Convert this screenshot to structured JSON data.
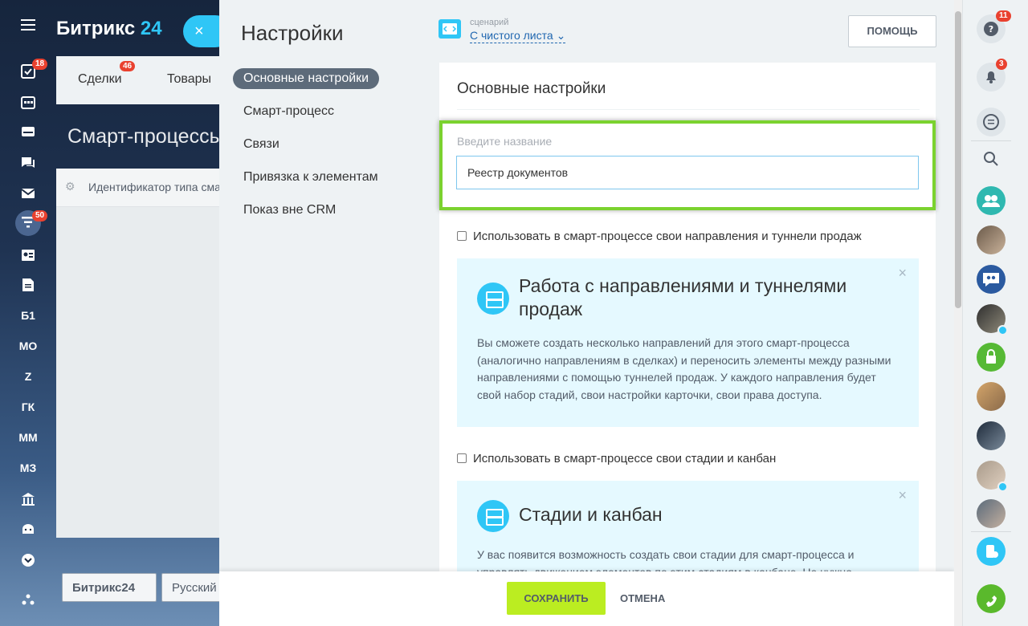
{
  "background": {
    "logo_text": "Битрикс",
    "logo_num": "24",
    "close_label": "×",
    "tabs": [
      {
        "label": "Сделки",
        "badge": "46"
      },
      {
        "label": "Товары"
      }
    ],
    "page_title": "Смарт-процессы",
    "table_row": "Идентификатор типа смарт-процесса",
    "footer_logo": "Битрикс24",
    "footer_lang": "Русский"
  },
  "left_nav": [
    {
      "icon": "tasks-icon",
      "badge": "18"
    },
    {
      "icon": "calendar-icon"
    },
    {
      "icon": "drive-icon"
    },
    {
      "icon": "chat-icon"
    },
    {
      "icon": "mail-icon"
    },
    {
      "icon": "crm-filter-icon",
      "badge": "50"
    },
    {
      "icon": "contact-card-icon"
    },
    {
      "icon": "document-icon"
    },
    {
      "label": "Б1"
    },
    {
      "label": "МО"
    },
    {
      "label": "Z"
    },
    {
      "label": "ГК"
    },
    {
      "label": "ММ"
    },
    {
      "label": "МЗ"
    },
    {
      "icon": "bank-icon"
    },
    {
      "icon": "android-icon"
    },
    {
      "icon": "chevron-down-icon"
    },
    {
      "icon": "structure-icon"
    }
  ],
  "slider": {
    "menu_title": "Настройки",
    "menu": [
      "Основные настройки",
      "Смарт-процесс",
      "Связи",
      "Привязка к элементам",
      "Показ вне CRM"
    ],
    "active_menu": 0,
    "scenario_label": "сценарий",
    "scenario_value": "С чистого листа",
    "help_button": "ПОМОЩЬ",
    "card_title": "Основные настройки",
    "name_label": "Введите название",
    "name_value": "Реестр документов",
    "checkbox1": "Использовать в смарт-процессе свои направления и туннели продаж",
    "info1_title": "Работа с направлениями и туннелями продаж",
    "info1_text": "Вы сможете создать несколько направлений для этого смарт-процесса (аналогично направлениям в сделках) и переносить элементы между разными направлениями с помощью туннелей продаж. У каждого направления будет свой набор стадий, свои настройки карточки, свои права доступа.",
    "checkbox2": "Использовать в смарт-процессе свои стадии и канбан",
    "info2_title": "Стадии и канбан",
    "info2_text": "У вас появится возможность создать свои стадии для смарт-процесса и управлять движением элементов по этим стадиям в канбане. Не нужно",
    "close_glyph": "×",
    "save_button": "СОХРАНИТЬ",
    "cancel_button": "ОТМЕНА"
  },
  "right_panel": {
    "help_badge": "11",
    "notify_badge": "3"
  },
  "colors": {
    "accent": "#2fc6f6",
    "save": "#bbed21",
    "highlight": "#7bd22f",
    "badge": "#e9412f"
  }
}
